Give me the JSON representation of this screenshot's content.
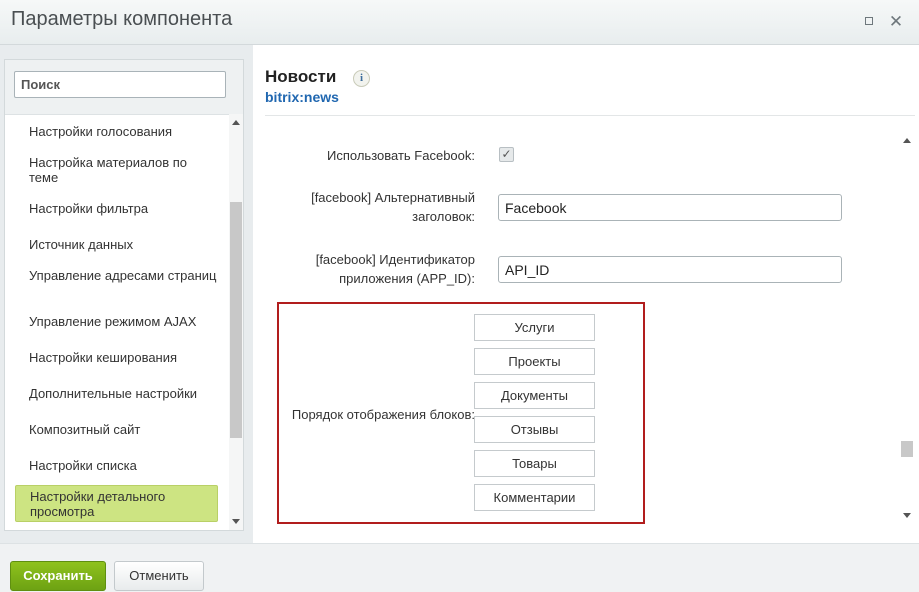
{
  "window": {
    "title": "Параметры компонента",
    "maximize_icon": "maximize-icon",
    "close_icon": "close-icon",
    "close_glyph": "✕"
  },
  "sidebar": {
    "search_placeholder": "Поиск",
    "items": [
      {
        "label": "Настройки голосования"
      },
      {
        "label": "Настройка материалов по теме"
      },
      {
        "label": "Настройки фильтра"
      },
      {
        "label": "Источник данных"
      },
      {
        "label": "Управление адресами страниц"
      },
      {
        "label": "Управление режимом AJAX"
      },
      {
        "label": "Настройки кеширования"
      },
      {
        "label": "Дополнительные настройки"
      },
      {
        "label": "Композитный сайт"
      },
      {
        "label": "Настройки списка"
      },
      {
        "label": "Настройки детального просмотра",
        "active": true
      }
    ]
  },
  "component": {
    "title": "Новости",
    "code": "bitrix:news",
    "info_icon": "i"
  },
  "fields": {
    "use_facebook_label": "Использовать Facebook:",
    "use_facebook_checked": true,
    "use_facebook_mark": "✓",
    "alt_title_label": "[facebook] Альтернативный заголовок:",
    "alt_title_value": "Facebook",
    "app_id_label": "[facebook] Идентификатор приложения (APP_ID):",
    "app_id_value": "API_ID",
    "order_label": "Порядок отображения блоков:",
    "order_blocks": [
      "Услуги",
      "Проекты",
      "Документы",
      "Отзывы",
      "Товары",
      "Комментарии"
    ]
  },
  "footer": {
    "save_label": "Сохранить",
    "cancel_label": "Отменить"
  },
  "colors": {
    "save_button": "#7ab317",
    "active_item": "#cde482",
    "highlight_border": "#b11d1d",
    "link_blue": "#2067b0"
  }
}
